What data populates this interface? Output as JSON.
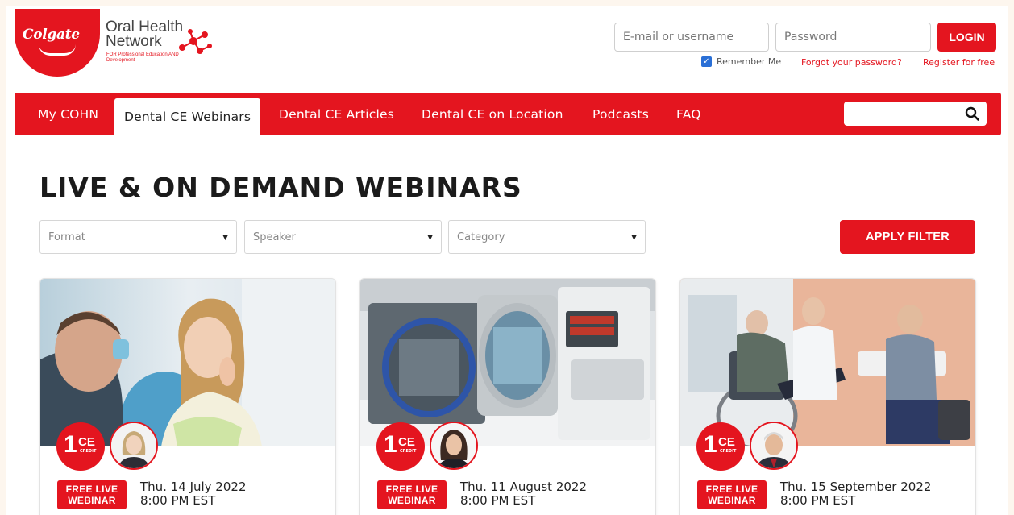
{
  "brand": {
    "logo_text": "Colgate",
    "network_name": "Oral Health Network",
    "network_tagline": "FOR Professional Education AND Development",
    "accent_color": "#e4151f"
  },
  "login": {
    "username_placeholder": "E-mail or username",
    "password_placeholder": "Password",
    "login_label": "LOGIN",
    "remember_label": "Remember Me",
    "forgot_label": "Forgot your password?",
    "register_label": "Register for free"
  },
  "nav": {
    "items": [
      {
        "label": "My COHN"
      },
      {
        "label": "Dental CE Webinars"
      },
      {
        "label": "Dental CE Articles"
      },
      {
        "label": "Dental CE on Location"
      },
      {
        "label": "Podcasts"
      },
      {
        "label": "FAQ"
      }
    ],
    "active_index": 1,
    "search_icon": "search-icon"
  },
  "main": {
    "title": "LIVE & ON DEMAND WEBINARS",
    "filters": [
      {
        "label": "Format"
      },
      {
        "label": "Speaker"
      },
      {
        "label": "Category"
      }
    ],
    "apply_label": "APPLY FILTER"
  },
  "cards": [
    {
      "ce_number": "1",
      "ce_text": "CE",
      "ce_credit": "CREDIT",
      "badge_line1": "FREE LIVE",
      "badge_line2": "WEBINAR",
      "date": "Thu. 14 July 2022",
      "time": "8:00 PM EST"
    },
    {
      "ce_number": "1",
      "ce_text": "CE",
      "ce_credit": "CREDIT",
      "badge_line1": "FREE LIVE",
      "badge_line2": "WEBINAR",
      "date": "Thu. 11 August 2022",
      "time": "8:00 PM EST"
    },
    {
      "ce_number": "1",
      "ce_text": "CE",
      "ce_credit": "CREDIT",
      "badge_line1": "FREE LIVE",
      "badge_line2": "WEBINAR",
      "date": "Thu. 15 September 2022",
      "time": "8:00 PM EST"
    }
  ]
}
